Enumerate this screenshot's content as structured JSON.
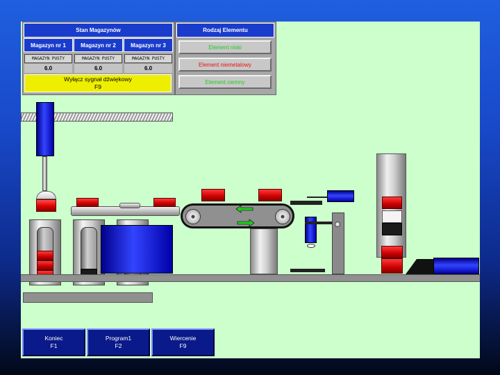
{
  "stan_magazynow": {
    "title": "Stan Magazynów",
    "magazines": [
      {
        "name": "Magazyn nr 1",
        "status": "MAGAZYN PUSTY",
        "value": "6.0"
      },
      {
        "name": "Magazyn nr 2",
        "status": "MAGAZYN PUSTY",
        "value": "6.0"
      },
      {
        "name": "Magazyn nr 3",
        "status": "MAGAZYN PUSTY",
        "value": "6.0"
      }
    ],
    "sound_button": {
      "label": "Wyłącz sygnał dźwiękowy",
      "key": "F9"
    }
  },
  "rodzaj_elementu": {
    "title": "Rodzaj Elementu",
    "items": [
      {
        "label": "Element niski",
        "color": "#22cc22"
      },
      {
        "label": "Element niemetalowy",
        "color": "#ee1111"
      },
      {
        "label": "Element ciemny",
        "color": "#22cc22"
      }
    ]
  },
  "function_keys": [
    {
      "label": "Koniec",
      "key": "F1"
    },
    {
      "label": "Program1",
      "key": "F2"
    },
    {
      "label": "Wiercenie",
      "key": "F9"
    }
  ],
  "colors": {
    "background_panel": "#ccffcc",
    "header_blue": "#1a3ccc",
    "warning_yellow": "#eeee00",
    "button_blue": "#0a1a8a"
  },
  "icons": [
    "arrow-left-icon",
    "arrow-right-icon"
  ]
}
